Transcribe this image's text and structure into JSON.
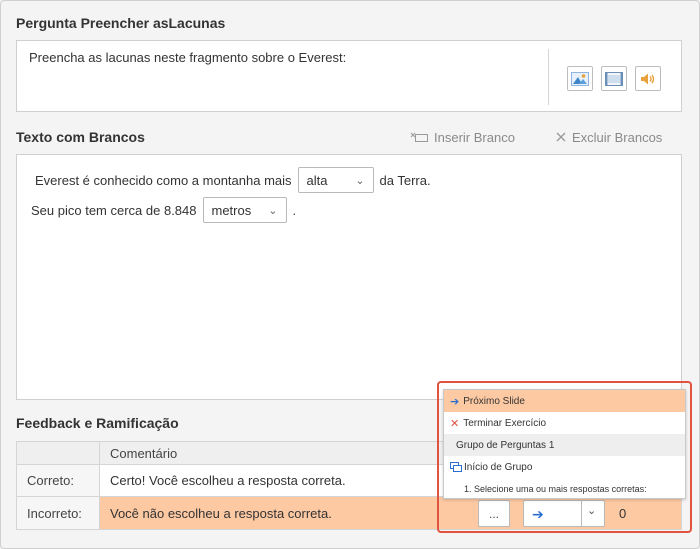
{
  "question": {
    "title": "Pergunta Preencher asLacunas",
    "prompt": "Preencha as lacunas neste fragmento sobre o Everest:",
    "media_buttons": [
      {
        "icon": "image-icon"
      },
      {
        "icon": "video-icon"
      },
      {
        "icon": "audio-icon"
      }
    ]
  },
  "blanks_section": {
    "title": "Texto com Brancos",
    "insert_label": "Inserir Branco",
    "delete_label": "Excluir Brancos",
    "line1_before": "Everest é conhecido como a montanha mais",
    "line1_select": "alta",
    "line1_after": "da Terra.",
    "line2_before": "Seu pico tem cerca de 8.848",
    "line2_select": "metros",
    "line2_after": "."
  },
  "feedback": {
    "title": "Feedback e Ramificação",
    "column_header": "Comentário",
    "rows": [
      {
        "label": "Correto:",
        "comment": "Certo! Você escolheu a resposta correta."
      },
      {
        "label": "Incorreto:",
        "comment": "Você não escolheu a resposta correta."
      }
    ],
    "more_label": "...",
    "points_value": "0"
  },
  "branch_dropdown": {
    "options": [
      {
        "label": "Próximo Slide",
        "icon": "arrow-right-icon",
        "selected": true
      },
      {
        "label": "Terminar Exercício",
        "icon": "close-x-icon"
      },
      {
        "label": "Grupo de Perguntas 1",
        "icon": ""
      },
      {
        "label": "Início de Grupo",
        "icon": "group-icon"
      },
      {
        "label": "1. Selecione uma ou mais respostas corretas:",
        "icon": ""
      }
    ]
  },
  "colors": {
    "accent_orange": "#fdc9a3",
    "highlight_red": "#e0533f",
    "arrow_blue": "#2c6fd1"
  }
}
